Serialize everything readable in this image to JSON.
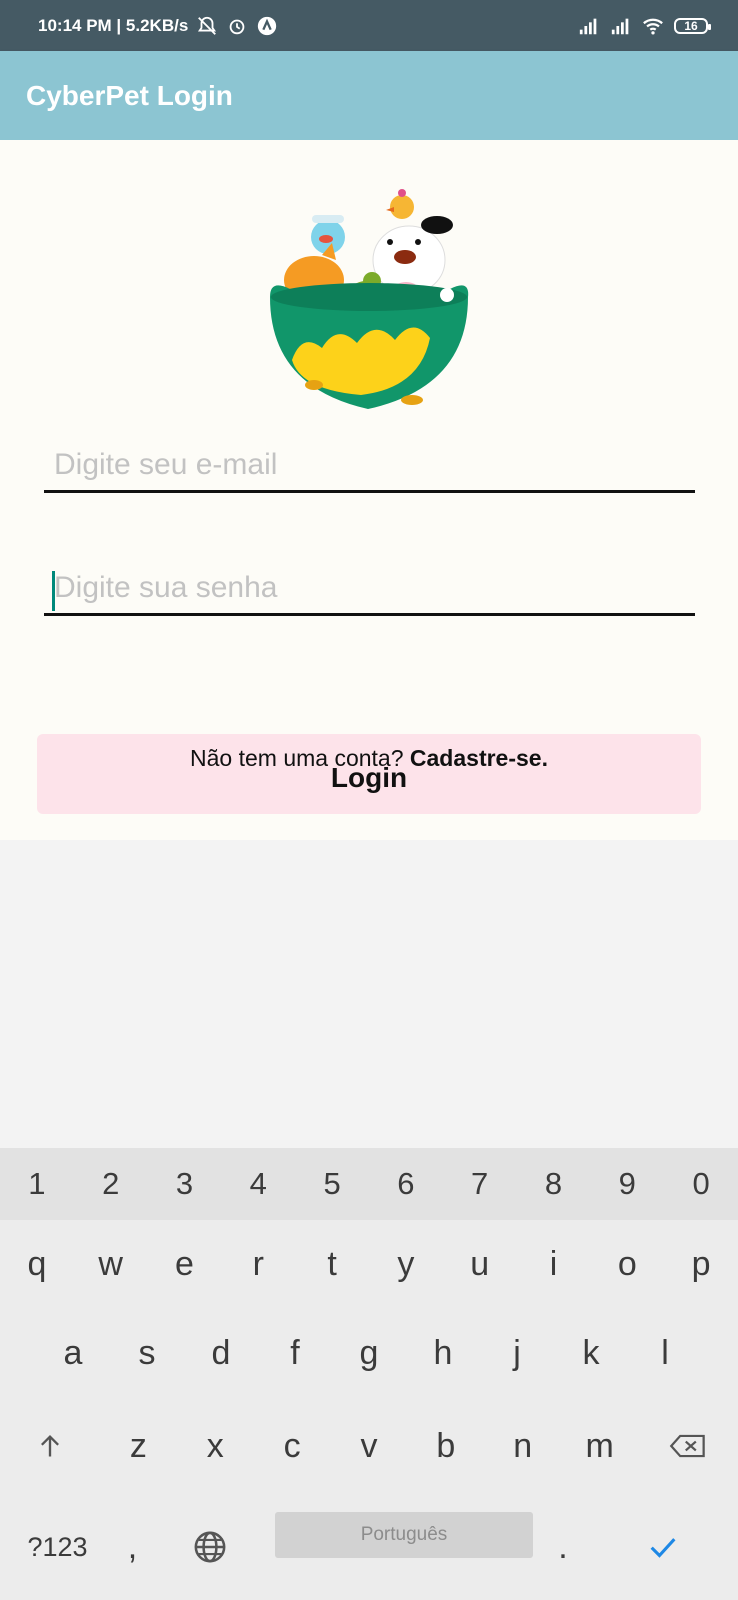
{
  "status_bar": {
    "time_speed": "10:14 PM | 5.2KB/s",
    "battery": "16"
  },
  "app_bar": {
    "title": "CyberPet Login"
  },
  "form": {
    "email_placeholder": "Digite seu e-mail",
    "password_placeholder": "Digite sua senha",
    "login_label": "Login",
    "signup_prefix": "Não tem uma conta? ",
    "signup_link": "Cadastre-se."
  },
  "keyboard": {
    "numbers": [
      "1",
      "2",
      "3",
      "4",
      "5",
      "6",
      "7",
      "8",
      "9",
      "0"
    ],
    "row1": [
      "q",
      "w",
      "e",
      "r",
      "t",
      "y",
      "u",
      "i",
      "o",
      "p"
    ],
    "row2": [
      "a",
      "s",
      "d",
      "f",
      "g",
      "h",
      "j",
      "k",
      "l"
    ],
    "row3": [
      "z",
      "x",
      "c",
      "v",
      "b",
      "n",
      "m"
    ],
    "symbols_key": "?123",
    "comma_key": ",",
    "space_label": "Português",
    "period_key": "."
  },
  "colors": {
    "status_bar": "#455a64",
    "app_bar": "#8cc5d2",
    "content_bg": "#fdfcf7",
    "login_button": "#fde3ea",
    "caret": "#00897b",
    "enter_check": "#1e88e5"
  }
}
